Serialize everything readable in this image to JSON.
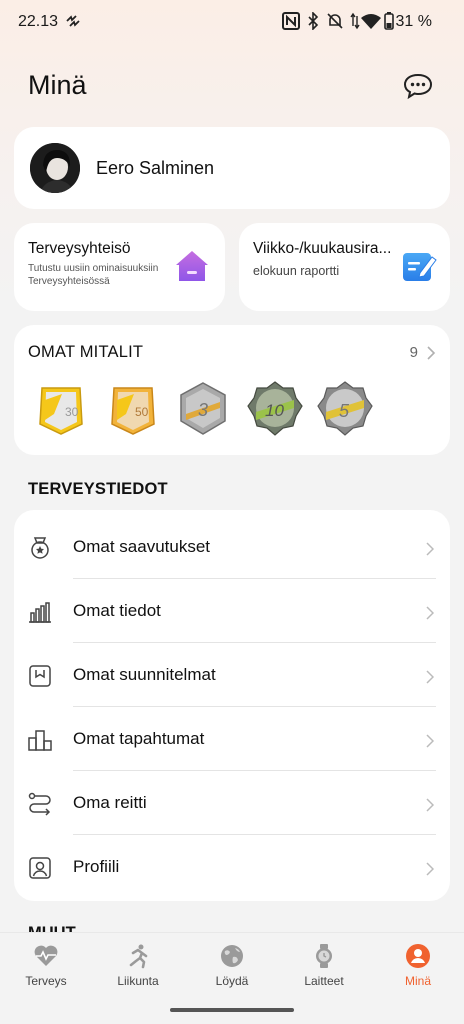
{
  "status_bar": {
    "time": "22.13",
    "battery": "31 %",
    "icons": [
      "nfc-icon",
      "bluetooth-icon",
      "mute-icon",
      "data-icon",
      "wifi-icon",
      "battery-icon"
    ]
  },
  "header": {
    "title": "Minä",
    "chat_icon": "chat-bubble-icon"
  },
  "profile": {
    "name": "Eero Salminen"
  },
  "cards": {
    "community": {
      "title": "Terveysyhteisö",
      "subtitle": "Tutustu uusiin ominaisuuksiin Terveysyhteisössä",
      "icon": "house-icon"
    },
    "report": {
      "title": "Viikko-/kuukausira...",
      "subtitle": "elokuun raportti",
      "icon": "report-edit-icon"
    }
  },
  "medals": {
    "title": "OMAT MITALIT",
    "count": "9",
    "colors": [
      "#f2c21c",
      "#f2b63a",
      "#9c9c9c",
      "#8ab04a",
      "#d8c030"
    ]
  },
  "health_section": {
    "title": "TERVEYSTIEDOT",
    "items": [
      {
        "label": "Omat saavutukset",
        "icon": "medal-icon"
      },
      {
        "label": "Omat tiedot",
        "icon": "bar-chart-icon"
      },
      {
        "label": "Omat suunnitelmat",
        "icon": "plan-icon"
      },
      {
        "label": "Omat tapahtumat",
        "icon": "podium-icon"
      },
      {
        "label": "Oma reitti",
        "icon": "route-icon"
      },
      {
        "label": "Profiili",
        "icon": "profile-icon"
      }
    ]
  },
  "more_section": {
    "title": "MUUT"
  },
  "bottom_nav": {
    "items": [
      {
        "label": "Terveys",
        "icon": "heart-pulse-icon",
        "active": false
      },
      {
        "label": "Liikunta",
        "icon": "running-icon",
        "active": false
      },
      {
        "label": "Löydä",
        "icon": "globe-icon",
        "active": false
      },
      {
        "label": "Laitteet",
        "icon": "watch-icon",
        "active": false
      },
      {
        "label": "Minä",
        "icon": "person-icon",
        "active": true
      }
    ],
    "accent": "#f0622f"
  }
}
